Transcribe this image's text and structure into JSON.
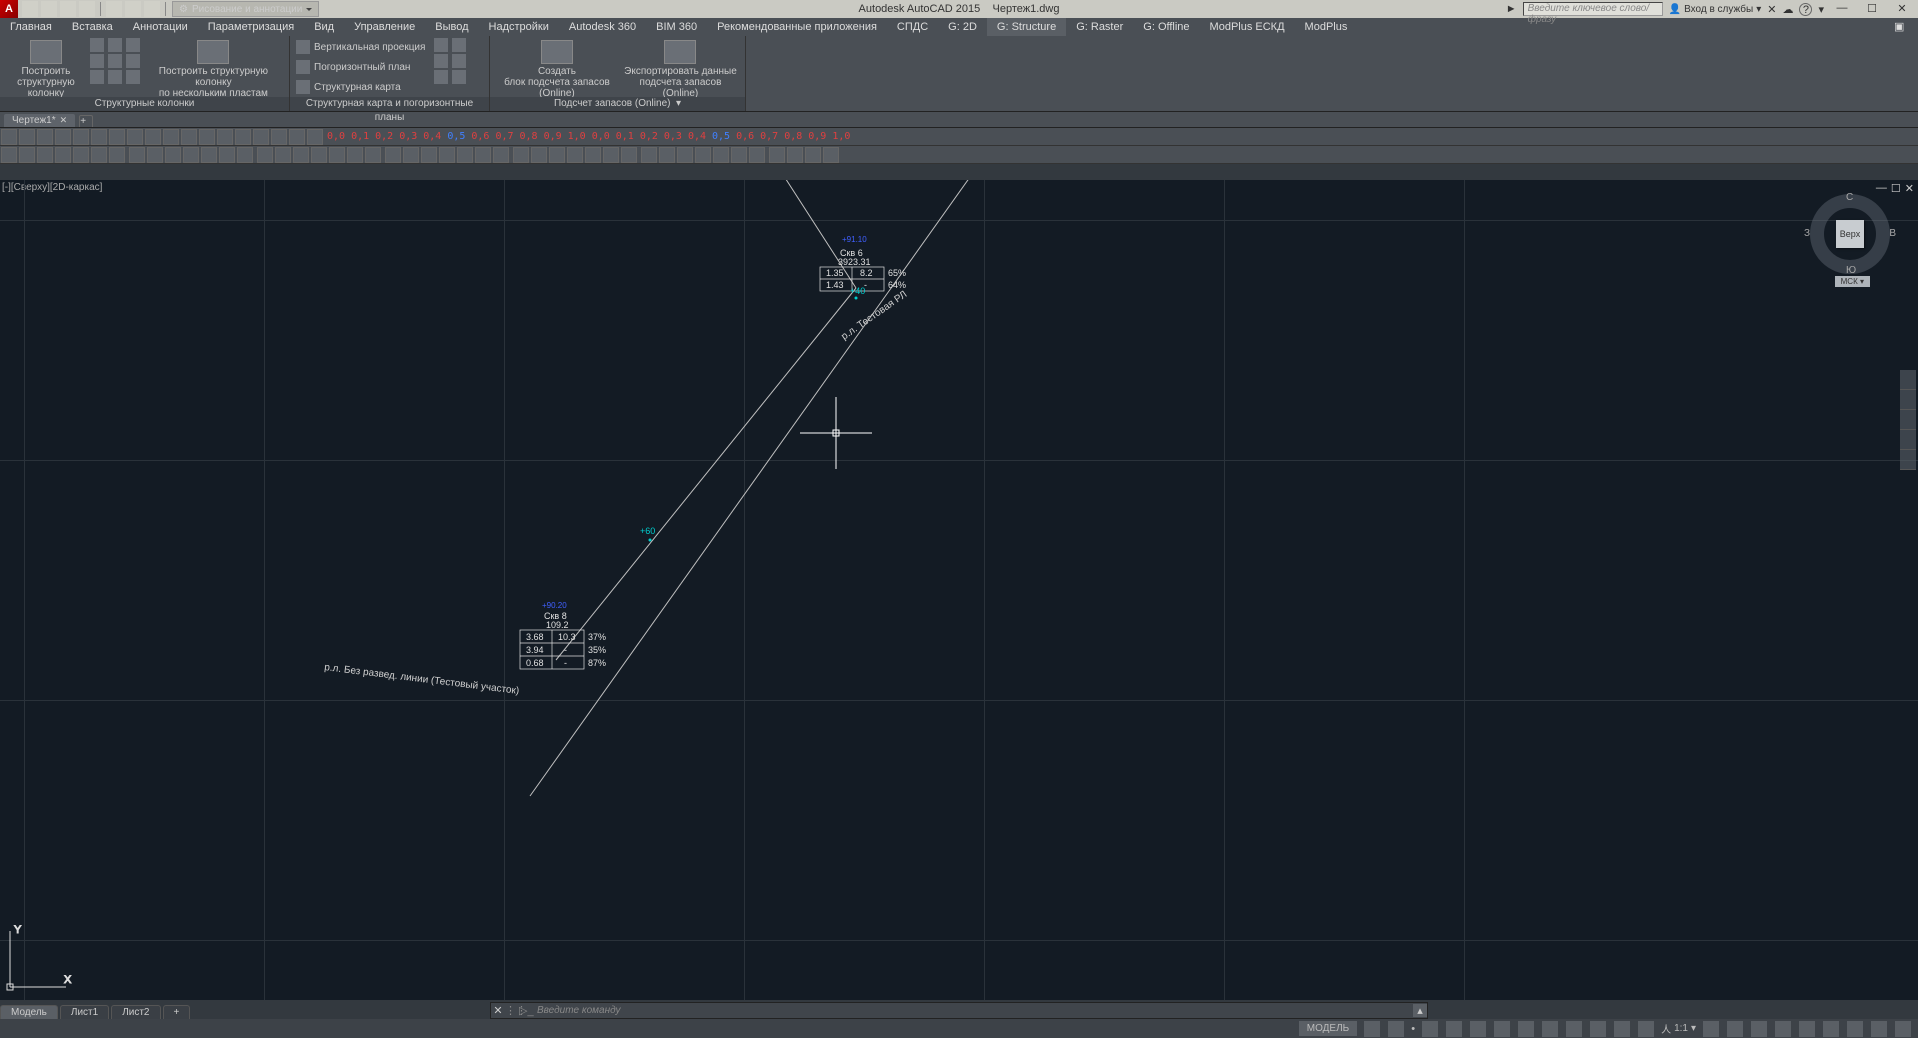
{
  "title": {
    "app": "Autodesk AutoCAD 2015",
    "doc": "Чертеж1.dwg"
  },
  "workspace_label": "Рисование и аннотации",
  "search_placeholder": "Введите ключевое слово/фразу",
  "signin_label": "Вход в службы",
  "menus": [
    "Главная",
    "Вставка",
    "Аннотации",
    "Параметризация",
    "Вид",
    "Управление",
    "Вывод",
    "Надстройки",
    "Autodesk 360",
    "BIM 360",
    "Рекомендованные приложения",
    "СПДС",
    "G: 2D",
    "G: Structure",
    "G: Raster",
    "G: Offline",
    "ModPlus ЕСКД",
    "ModPlus"
  ],
  "active_menu": "G: Structure",
  "ribbon": {
    "panel1": {
      "title": "Структурные колонки",
      "btn1": "Построить\nструктурную колонку",
      "btn2": "Построить структурную колонку\nпо нескольким пластам"
    },
    "panel2": {
      "title": "Структурная карта и погоризонтные планы",
      "opt1": "Вертикальная проекция",
      "opt2": "Погоризонтный план",
      "opt3": "Структурная карта"
    },
    "panel3": {
      "title": "Подсчет запасов (Online)",
      "btn1": "Создать\nблок подсчета запасов (Online)",
      "btn2": "Экспортировать данные\nподсчета запасов (Online)"
    }
  },
  "doc_tab": "Чертеж1*",
  "val_row": [
    "0,0",
    "0,1",
    "0,2",
    "0,3",
    "0,4",
    "0,5",
    "0,6",
    "0,7",
    "0,8",
    "0,9",
    "1,0",
    "0,0",
    "0,1",
    "0,2",
    "0,3",
    "0,4",
    "0,5",
    "0,6",
    "0,7",
    "0,8",
    "0,9",
    "1,0"
  ],
  "view_label": "[-][Сверху][2D-каркас]",
  "viewcube": {
    "face": "Верх",
    "n": "С",
    "s": "Ю",
    "w": "З",
    "e": "В",
    "wcs": "МСК"
  },
  "drawing": {
    "skv6": {
      "name": "Скв 6",
      "sub": "3923.31",
      "row1": [
        "1.35",
        "8.2",
        "65%"
      ],
      "row2": [
        "1.43",
        "-",
        "64%"
      ],
      "mark": "+40"
    },
    "line_label_top": "р.л. Тестовая РЛ",
    "pt_mid": "+60",
    "skv8": {
      "name": "Скв 8",
      "sub": "109.2",
      "row1": [
        "3.68",
        "10.3",
        "37%"
      ],
      "row2": [
        "3.94",
        "-",
        "35%"
      ],
      "row3": [
        "0.68",
        "-",
        "87%"
      ]
    },
    "line_label_bottom": "р.л. Без развед. линии (Тестовый участок)"
  },
  "sheet_tabs": [
    "Модель",
    "Лист1",
    "Лист2"
  ],
  "cmd_placeholder": "Введите команду",
  "status": {
    "model": "МОДЕЛЬ",
    "scale": "1:1"
  }
}
